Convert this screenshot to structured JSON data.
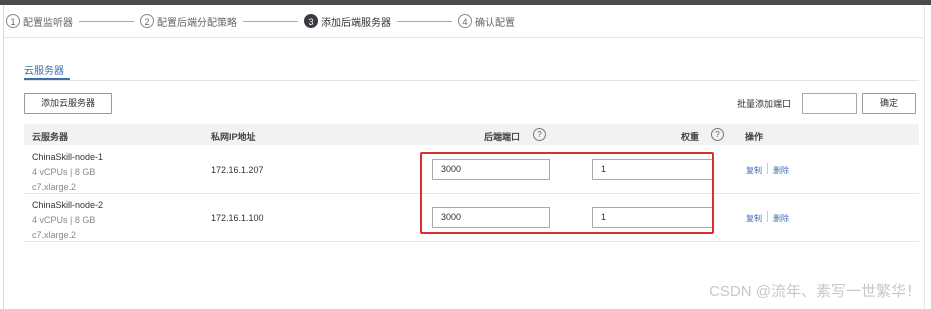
{
  "steps": [
    {
      "num": "1",
      "label": "配置监听器",
      "active": false
    },
    {
      "num": "2",
      "label": "配置后端分配策略",
      "active": false
    },
    {
      "num": "3",
      "label": "添加后端服务器",
      "active": true
    },
    {
      "num": "4",
      "label": "确认配置",
      "active": false
    }
  ],
  "tab": {
    "label": "云服务器"
  },
  "toolbar": {
    "add_button": "添加云服务器",
    "batch_port_label": "批量添加端口",
    "batch_port_value": "",
    "ok_button": "确定"
  },
  "table": {
    "headers": {
      "server": "云服务器",
      "private_ip": "私网IP地址",
      "backend_port": "后端端口",
      "weight": "权重",
      "actions": "操作"
    },
    "help_glyph": "?",
    "rows": [
      {
        "name": "ChinaSkill-node-1",
        "spec": "4 vCPUs | 8 GB",
        "flavor": "c7.xlarge.2",
        "ip": "172.16.1.207",
        "port": "3000",
        "weight": "1",
        "copy": "复制",
        "delete": "删除"
      },
      {
        "name": "ChinaSkill-node-2",
        "spec": "4 vCPUs | 8 GB",
        "flavor": "c7.xlarge.2",
        "ip": "172.16.1.100",
        "port": "3000",
        "weight": "1",
        "copy": "复制",
        "delete": "删除"
      }
    ]
  },
  "watermark": "CSDN @流年、素写一世繁华！",
  "colors": {
    "accent": "#3f6ea8",
    "highlight": "#d9302f",
    "active_step": "#3a3a40"
  }
}
